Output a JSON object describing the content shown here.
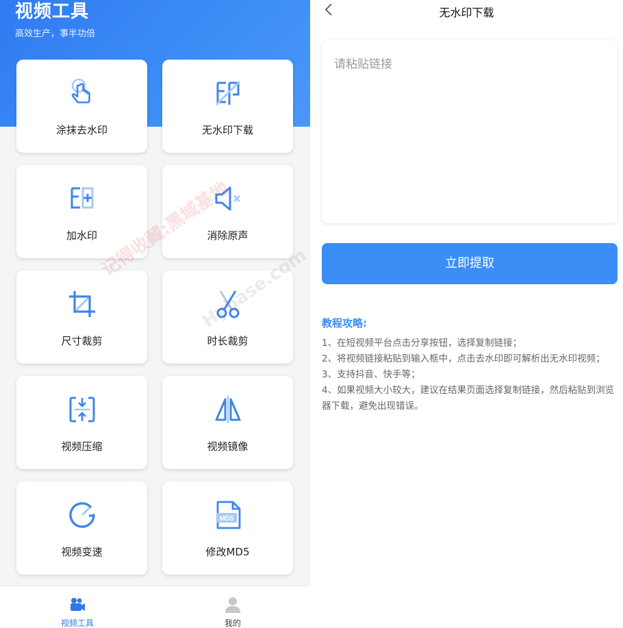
{
  "home": {
    "title": "视频工具",
    "subtitle": "高效生产，事半功倍",
    "tools": [
      {
        "label": "涂抹去水印",
        "icon": "tap-hand-icon"
      },
      {
        "label": "无水印下载",
        "icon": "no-watermark-icon"
      },
      {
        "label": "加水印",
        "icon": "add-watermark-icon"
      },
      {
        "label": "消除原声",
        "icon": "mute-icon"
      },
      {
        "label": "尺寸裁剪",
        "icon": "crop-icon"
      },
      {
        "label": "时长裁剪",
        "icon": "scissors-icon"
      },
      {
        "label": "视频压缩",
        "icon": "compress-icon"
      },
      {
        "label": "视频镜像",
        "icon": "mirror-icon"
      },
      {
        "label": "视频变速",
        "icon": "speed-gauge-icon"
      },
      {
        "label": "修改MD5",
        "icon": "md5-file-icon"
      }
    ],
    "md5_text": "MD5",
    "tabs": [
      {
        "label": "视频工具",
        "icon": "video-camera-icon",
        "active": true
      },
      {
        "label": "我的",
        "icon": "user-icon",
        "active": false
      }
    ],
    "watermark": "记得收藏:黑域基地",
    "watermark2": "Hybase.com"
  },
  "download": {
    "title": "无水印下载",
    "input_placeholder": "请粘贴链接",
    "input_value": "",
    "extract_label": "立即提取",
    "tutorial_title": "教程攻略:",
    "tutorial_steps": [
      "1、在短视频平台点击分享按钮，选择复制链接；",
      "2、将视频链接粘贴到输入框中，点击去水印即可解析出无水印视频；",
      "3、支持抖音、快手等；",
      "4、如果视频大小较大，建议在结果页面选择复制链接，然后粘贴到浏览器下载，避免出现错误。"
    ]
  },
  "colors": {
    "brand_blue": "#3a8ef6",
    "icon_blue": "#3f86ea",
    "tab_active": "#2f78e8",
    "tab_inactive": "#666666"
  }
}
